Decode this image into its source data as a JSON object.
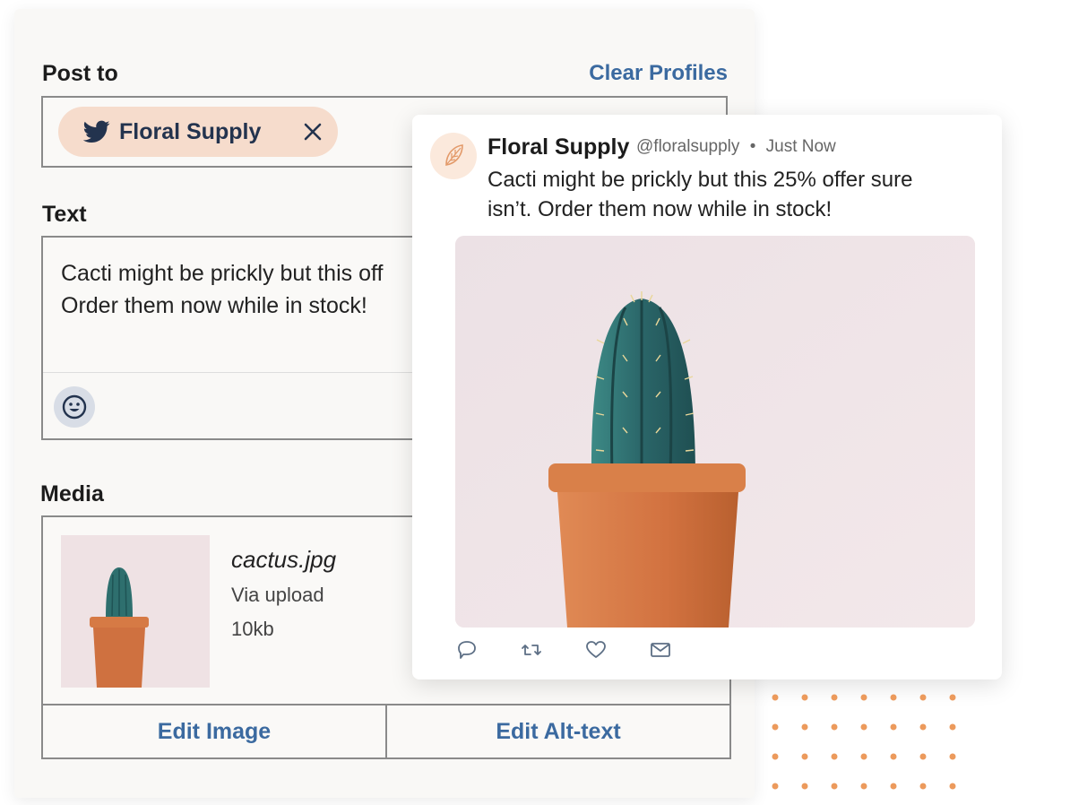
{
  "composer": {
    "post_to_label": "Post to",
    "clear_profiles_label": "Clear Profiles",
    "profile_chip": {
      "label": "Floral Supply",
      "icon": "twitter-bird-icon"
    },
    "text_label": "Text",
    "text_value": "Cacti might be prickly but this off\nOrder them now while in stock!",
    "media_label": "Media",
    "media": {
      "file_name": "cactus.jpg",
      "source": "Via upload",
      "size": "10kb",
      "edit_image_label": "Edit Image",
      "edit_alt_label": "Edit Alt-text"
    }
  },
  "tweet_preview": {
    "name": "Floral Supply",
    "handle": "@floralsupply",
    "separator": "•",
    "time": "Just Now",
    "text": "Cacti might be prickly but this 25% offer sure isn’t. Order them now while in stock!",
    "actions": [
      "reply-icon",
      "retweet-icon",
      "like-icon",
      "mail-icon"
    ]
  },
  "colors": {
    "accent": "#3b6aa0",
    "chip_bg": "#f6dccc",
    "dots": "#ec9a5c",
    "pot": "#d67a45",
    "cactus": "#2e6f6e"
  }
}
